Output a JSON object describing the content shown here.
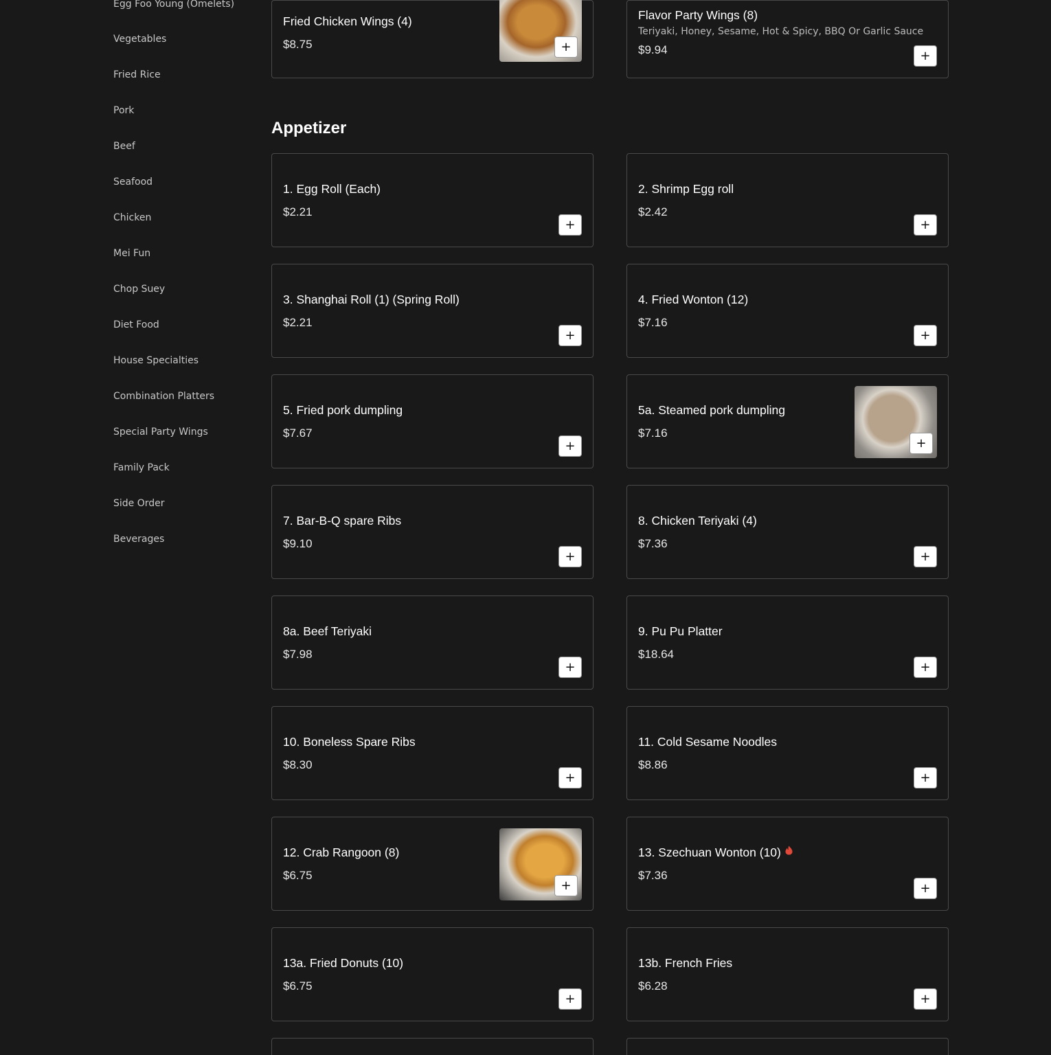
{
  "sidebar": {
    "categories": [
      "Egg Foo Young (Omelets)",
      "Vegetables",
      "Fried Rice",
      "Pork",
      "Beef",
      "Seafood",
      "Chicken",
      "Mei Fun",
      "Chop Suey",
      "Diet Food",
      "House Specialties",
      "Combination Platters",
      "Special Party Wings",
      "Family Pack",
      "Side Order",
      "Beverages"
    ]
  },
  "wings": {
    "items": [
      {
        "name": "Fried Chicken Wings (4)",
        "price": "$8.75",
        "image": "chicken-wings-photo"
      },
      {
        "name": "Flavor Party Wings (8)",
        "description": "Teriyaki, Honey, Sesame, Hot & Spicy, BBQ Or Garlic Sauce",
        "price": "$9.94"
      }
    ]
  },
  "appetizer": {
    "title": "Appetizer",
    "items": [
      {
        "name": "1. Egg Roll (Each)",
        "price": "$2.21"
      },
      {
        "name": "2. Shrimp Egg roll",
        "price": "$2.42"
      },
      {
        "name": "3. Shanghai Roll (1) (Spring Roll)",
        "price": "$2.21"
      },
      {
        "name": "4. Fried Wonton (12)",
        "price": "$7.16"
      },
      {
        "name": "5. Fried pork dumpling",
        "price": "$7.67"
      },
      {
        "name": "5a. Steamed pork dumpling",
        "price": "$7.16",
        "image": "steamed-dumpling-photo"
      },
      {
        "name": "7. Bar-B-Q spare Ribs",
        "price": "$9.10"
      },
      {
        "name": "8. Chicken Teriyaki (4)",
        "price": "$7.36"
      },
      {
        "name": "8a. Beef Teriyaki",
        "price": "$7.98"
      },
      {
        "name": "9. Pu Pu Platter",
        "price": "$18.64"
      },
      {
        "name": "10. Boneless Spare Ribs",
        "price": "$8.30"
      },
      {
        "name": "11. Cold Sesame Noodles",
        "price": "$8.86"
      },
      {
        "name": "12. Crab Rangoon (8)",
        "price": "$6.75",
        "image": "crab-rangoon-photo"
      },
      {
        "name": "13. Szechuan Wonton (10)",
        "price": "$7.36",
        "icon": "spicy-icon"
      },
      {
        "name": "13a. Fried Donuts (10)",
        "price": "$6.75"
      },
      {
        "name": "13b. French Fries",
        "price": "$6.28"
      }
    ]
  },
  "add_button": {
    "label": "+"
  },
  "colors": {
    "background": "#191919",
    "card_border": "#4a4a4a",
    "spicy": "#e0483a"
  }
}
